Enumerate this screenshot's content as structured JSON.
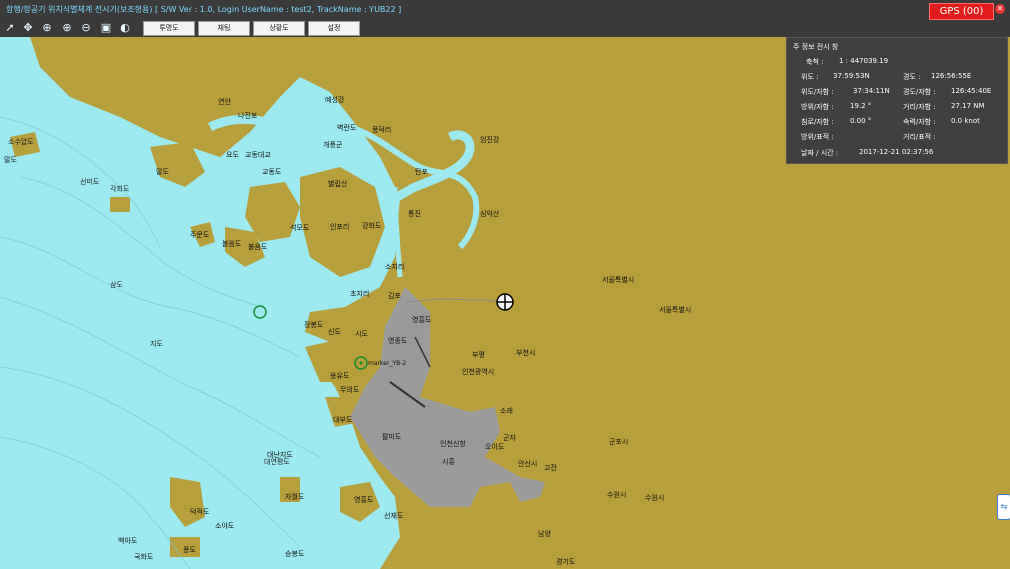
{
  "title": "항행/항공기 위치식별체계 전시기(보조형용)  [ S/W Ver : 1.0,   Login UserName : test2,   TrackName : YUB22 ]",
  "gps_button": "GPS (00)",
  "toolbar": {
    "icons": [
      "select-arrow",
      "pan-move",
      "zoom-area",
      "zoom-in",
      "zoom-out",
      "layer-window",
      "day-night"
    ],
    "buttons": [
      "투명도",
      "채팅",
      "상황도",
      "설정"
    ]
  },
  "info_panel": {
    "title": "주 정보 전시 창",
    "scale_label": "축척 :",
    "scale_value": "1 : 447039.19",
    "rows": [
      {
        "k1": "위도 :",
        "v1": "37:59:53N",
        "k2": "경도 :",
        "v2": "126:56:55E"
      },
      {
        "k1": "위도/자함 :",
        "v1": "37:34:11N",
        "k2": "경도/자함 :",
        "v2": "126:45:40E"
      },
      {
        "k1": "방위/자함 :",
        "v1": "19.2 °",
        "k2": "거리/자함 :",
        "v2": "27.17 NM"
      },
      {
        "k1": "침로/자함 :",
        "v1": "0.00 °",
        "k2": "속력/자함 :",
        "v2": "0.0 knot"
      },
      {
        "k1": "방위/표적 :",
        "v1": "",
        "k2": "거리/표적 :",
        "v2": ""
      }
    ],
    "datetime_label": "날짜 / 시간 :",
    "datetime_value": "2017-12-21 02:37:56"
  },
  "map_labels": {
    "places": [
      "연안",
      "나진포",
      "예성강",
      "요도",
      "교동도",
      "교동대교",
      "벽란도",
      "개풍군",
      "풍덕리",
      "임진강",
      "탄포",
      "별립산",
      "강화도",
      "통진",
      "심악산",
      "인포리",
      "석모도",
      "주문도",
      "불음도",
      "소지리",
      "김포",
      "초지리",
      "부평",
      "부천시",
      "서울특별시",
      "서울특별시 ",
      "영종도",
      "영흥도",
      "인천광역시",
      "대부도",
      "팔미도",
      "소래",
      "군자",
      "오이도",
      "인천신항",
      "시흥",
      "안산시",
      "고잔",
      "군포시",
      "수원시",
      "수원시 ",
      "영흥도 ",
      "선재도",
      "덕적도",
      "소야도",
      "백아도",
      "장봉도",
      "신도",
      "시도",
      "무의도",
      "용유도",
      "자월도",
      "승봉도",
      "풍도",
      "대난지도",
      "남양",
      "경기도",
      "국화도",
      "말도",
      "소수압도",
      "각회도",
      "볼음도",
      "선미도",
      "대연평도",
      "삼도",
      "지도",
      "말도 "
    ],
    "track_label": "marker_YB-2"
  },
  "colors": {
    "sea": "#9ceaf0",
    "land": "#b79f3c",
    "restricted": "#9a9a9a",
    "panel": "#3f3f3f",
    "gps": "#e21c1c"
  }
}
